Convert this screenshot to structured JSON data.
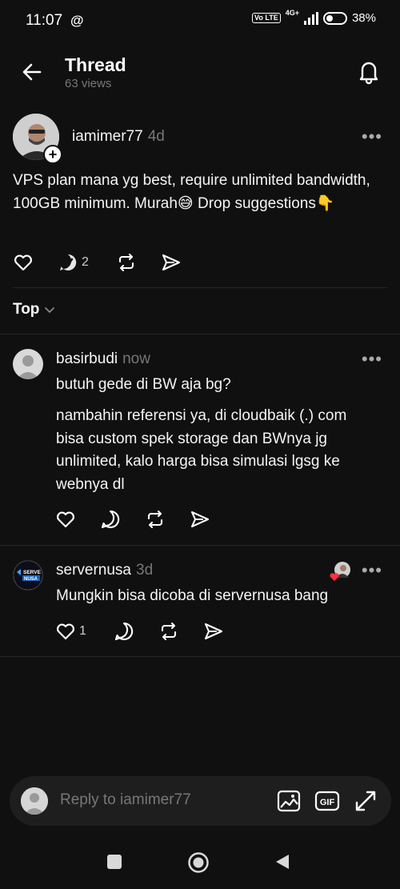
{
  "status_bar": {
    "time": "11:07",
    "app_glyph": "@",
    "volte": "Vo LTE",
    "network": "4G+",
    "battery_percent": "38%",
    "battery_level": 0.38
  },
  "header": {
    "title": "Thread",
    "views": "63 views"
  },
  "post": {
    "username": "iamimer77",
    "time": "4d",
    "text": "VPS plan mana yg best, require unlimited bandwidth, 100GB minimum. Murah😅 Drop suggestions👇",
    "reply_count": "2",
    "more": "•••"
  },
  "sort": {
    "label": "Top"
  },
  "replies": [
    {
      "username": "basirbudi",
      "time": "now",
      "text1": "butuh gede di BW aja bg?",
      "text2": "nambahin referensi ya, di cloudbaik (.) com bisa custom spek storage dan BWnya jg unlimited, kalo harga bisa simulasi lgsg ke webnya dl",
      "like_count": ""
    },
    {
      "username": "servernusa",
      "time": "3d",
      "text1": "Mungkin bisa dicoba di servernusa bang",
      "like_count": "1",
      "avatar_text_1": "SERVE",
      "avatar_text_2": "NUSA"
    }
  ],
  "composer": {
    "placeholder": "Reply to iamimer77",
    "gif_label": "GIF"
  },
  "colors": {
    "background": "#101010",
    "text": "#f3f5f7",
    "muted": "#777777",
    "composer_bg": "#1e1e1e",
    "heart_red": "#ff3040"
  }
}
